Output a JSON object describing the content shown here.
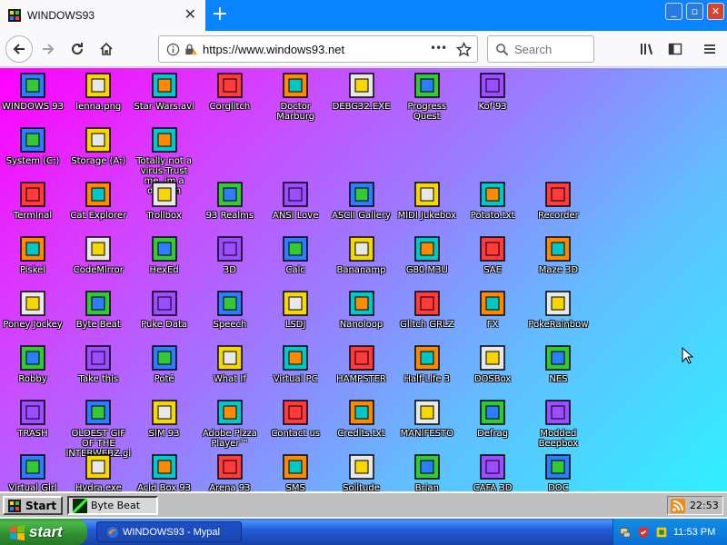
{
  "browser": {
    "tab_title": "WINDOWS93",
    "tab_close": "✕",
    "new_tab": "+",
    "window_controls": {
      "minimize": "_",
      "maximize": "▫",
      "close": "✕"
    },
    "url": "https://www.windows93.net",
    "search_placeholder": "Search",
    "page_actions": "•••"
  },
  "desktop": {
    "icons": [
      {
        "label": "WINDOWS 93",
        "icon": "computer-icon"
      },
      {
        "label": "lenna.png",
        "icon": "image-file-icon"
      },
      {
        "label": "Star Wars.avi",
        "icon": "yoda-icon"
      },
      {
        "label": "Corglitch",
        "icon": "corgi-icon"
      },
      {
        "label": "Doctor Marburg",
        "icon": "doctor-icon"
      },
      {
        "label": "DEBG32.EXE",
        "icon": "monitor-face-icon"
      },
      {
        "label": "Progress Quest",
        "icon": "crossed-swords-icon"
      },
      {
        "label": "Kof'93",
        "icon": "fighter-portrait-icon"
      },
      {
        "label": "System (C:)",
        "icon": "hard-drive-icon"
      },
      {
        "label": "Storage (A:)",
        "icon": "floppy-drive-icon"
      },
      {
        "label": "Totally not a virus.Trust me..im a dolphin",
        "icon": "dolphin-icon"
      },
      {
        "label": "Terminal",
        "icon": "terminal-icon"
      },
      {
        "label": "Cat Explorer",
        "icon": "cat-globe-icon"
      },
      {
        "label": "Trollbox",
        "icon": "trollbox-icon"
      },
      {
        "label": "93 Realms",
        "icon": "knight-icon"
      },
      {
        "label": "ANSI Love",
        "icon": "ansi-letter-icon"
      },
      {
        "label": "ASCII Gallery",
        "icon": "numbers-icon"
      },
      {
        "label": "MIDI Jukebox",
        "icon": "piano-keys-icon"
      },
      {
        "label": "Potato.txt",
        "icon": "potato-icon"
      },
      {
        "label": "Recorder",
        "icon": "microphone-icon"
      },
      {
        "label": "Piskel",
        "icon": "paint-palette-icon"
      },
      {
        "label": "CodeMirror",
        "icon": "hand-cursor-icon"
      },
      {
        "label": "HexEd",
        "icon": "blue-cube-icon"
      },
      {
        "label": "3D",
        "icon": "teapot-icon"
      },
      {
        "label": "Calc",
        "icon": "calculator-icon"
      },
      {
        "label": "Bananamp",
        "icon": "banana-icon"
      },
      {
        "label": "G80.M3U",
        "icon": "audio-file-icon"
      },
      {
        "label": "SAE",
        "icon": "amiga-ball-icon"
      },
      {
        "label": "Maze 3D",
        "icon": "maze-icon"
      },
      {
        "label": "Poney Jockey",
        "icon": "pony-icon"
      },
      {
        "label": "Byte Beat",
        "icon": "bytebeat-icon"
      },
      {
        "label": "Puke Data",
        "icon": "pd-icon"
      },
      {
        "label": "Speech",
        "icon": "speech-face-icon"
      },
      {
        "label": "LSDJ",
        "icon": "gameboy-icon"
      },
      {
        "label": "Nanoloop",
        "icon": "wave-lines-icon"
      },
      {
        "label": "Glitch GRLZ",
        "icon": "lips-icon"
      },
      {
        "label": "FX",
        "icon": "atom-icon"
      },
      {
        "label": "PokeRainbow",
        "icon": "pokemon-group-icon"
      },
      {
        "label": "Robby",
        "icon": "stick-figure-icon"
      },
      {
        "label": "Take this",
        "icon": "pixel-character-icon"
      },
      {
        "label": "Poté",
        "icon": "potato-small-icon"
      },
      {
        "label": "What If",
        "icon": "film-strip-icon"
      },
      {
        "label": "Virtual PC",
        "icon": "window-app-icon"
      },
      {
        "label": "HAMPSTER",
        "icon": "owl-icon"
      },
      {
        "label": "Half-Life 3",
        "icon": "half-life-icon"
      },
      {
        "label": "DOSBox",
        "icon": "dosbox-icon"
      },
      {
        "label": "NES",
        "icon": "nes-console-icon"
      },
      {
        "label": "TRASH",
        "icon": "trash-icon"
      },
      {
        "label": "OLDEST GIF OF THE INTERWEBZ.gif",
        "icon": "gif-file-icon"
      },
      {
        "label": "SIM 93",
        "icon": "sim-document-icon"
      },
      {
        "label": "Adobe Pizza Player™",
        "icon": "pizza-icon"
      },
      {
        "label": "Contact us",
        "icon": "contact-edit-icon"
      },
      {
        "label": "Credits.txt",
        "icon": "text-file-icon"
      },
      {
        "label": "MANIFESTO",
        "icon": "question-mark-icon"
      },
      {
        "label": "Defrag",
        "icon": "defrag-icon"
      },
      {
        "label": "Modded Beepbox",
        "icon": "green-ring-icon"
      },
      {
        "label": "Virtual Girl",
        "icon": "face-portrait-icon"
      },
      {
        "label": "Hydra.exe",
        "icon": "hydra-icon"
      },
      {
        "label": "Acid Box 93",
        "icon": "smiley-icon"
      },
      {
        "label": "Arena 93",
        "icon": "color-cube-icon"
      },
      {
        "label": "SMS",
        "icon": "sms-console-icon"
      },
      {
        "label": "Solitude",
        "icon": "bottle-icon"
      },
      {
        "label": "Brian",
        "icon": "spiky-icon"
      },
      {
        "label": "CAFA 3D",
        "icon": "doom-face-icon"
      },
      {
        "label": "DOC",
        "icon": "drive-unit-icon"
      }
    ]
  },
  "w93_taskbar": {
    "start_label": "Start",
    "task_label": "Byte Beat",
    "clock": "22:53"
  },
  "xp_taskbar": {
    "start_label": "start",
    "task_label": "WINDOWS93 - Mypal",
    "clock": "11:53 PM"
  }
}
